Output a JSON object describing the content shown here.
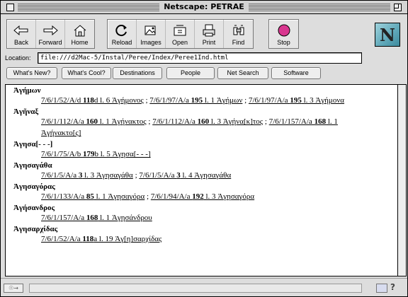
{
  "window": {
    "title": "Netscape: PETRAE"
  },
  "toolbar": {
    "group1": [
      {
        "label": "Back",
        "icon": "back-arrow-icon"
      },
      {
        "label": "Forward",
        "icon": "forward-arrow-icon"
      },
      {
        "label": "Home",
        "icon": "home-icon"
      }
    ],
    "group2": [
      {
        "label": "Reload",
        "icon": "reload-icon"
      },
      {
        "label": "Images",
        "icon": "images-icon"
      },
      {
        "label": "Open",
        "icon": "open-icon"
      },
      {
        "label": "Print",
        "icon": "print-icon"
      },
      {
        "label": "Find",
        "icon": "find-icon"
      }
    ],
    "group3": [
      {
        "label": "Stop",
        "icon": "stop-icon"
      }
    ],
    "logo": "N"
  },
  "location": {
    "label": "Location:",
    "value": "file:///d2Mac-5/Instal/Peree/Index/Peree1Ind.html"
  },
  "directory_buttons": [
    "What's New?",
    "What's Cool?",
    "Destinations",
    "People",
    "Net Search",
    "Software"
  ],
  "entries": [
    {
      "head": "Ἀγήμων",
      "lines": [
        [
          {
            "t": "7/6/1/52/A/d "
          },
          {
            "b": "118"
          },
          {
            "t": "d l. 6 Ἀγήμονος"
          },
          {
            "sep": " ; "
          },
          {
            "t": "7/6/1/97/A/a "
          },
          {
            "b": "195"
          },
          {
            "t": " l. 1 Ἀγήμων"
          },
          {
            "sep": " ; "
          },
          {
            "t": "7/6/1/97/A/a "
          },
          {
            "b": "195"
          },
          {
            "t": " l. 3 Ἀγήμονα"
          }
        ]
      ]
    },
    {
      "head": "Ἀγῆναξ",
      "lines": [
        [
          {
            "t": "7/6/1/112/A/a "
          },
          {
            "b": "160"
          },
          {
            "t": " l. 1 Ἀγήνακτος"
          },
          {
            "sep": " ; "
          },
          {
            "t": "7/6/1/112/A/a "
          },
          {
            "b": "160"
          },
          {
            "t": " l. 3 Ἀγήνα[κ]τος"
          },
          {
            "sep": " ; "
          },
          {
            "t": "7/6/1/157/A/a "
          },
          {
            "b": "168"
          },
          {
            "t": " l. 1"
          }
        ],
        [
          {
            "t": "Ἀγήνακτο[ς]"
          }
        ]
      ]
    },
    {
      "head": "Ἀγησα[- - -]",
      "lines": [
        [
          {
            "t": "7/6/1/75/A/b "
          },
          {
            "b": "179"
          },
          {
            "t": "b l. 5 Ἀγησα[- - -]"
          }
        ]
      ]
    },
    {
      "head": "Ἀγησαγάθα",
      "lines": [
        [
          {
            "t": "7/6/1/5/A/a "
          },
          {
            "b": "3"
          },
          {
            "t": " l. 3 Ἀγησαγάθα"
          },
          {
            "sep": " ; "
          },
          {
            "t": "7/6/1/5/A/a "
          },
          {
            "b": "3"
          },
          {
            "t": " l. 4 Ἀγησαγάθα"
          }
        ]
      ]
    },
    {
      "head": "Ἀγησαγόρας",
      "lines": [
        [
          {
            "t": "7/6/1/133/A/a "
          },
          {
            "b": "85"
          },
          {
            "t": " l. 1 Ἀγησαγόρα"
          },
          {
            "sep": " ; "
          },
          {
            "t": "7/6/1/94/A/a "
          },
          {
            "b": "192"
          },
          {
            "t": " l. 3 Ἀγησαγόρα"
          }
        ]
      ]
    },
    {
      "head": "Ἀγήσανδρος",
      "lines": [
        [
          {
            "t": "7/6/1/157/A/a "
          },
          {
            "b": "168"
          },
          {
            "t": " l. 1 Ἀγησάνδρου"
          }
        ]
      ]
    },
    {
      "head": "Ἀγησαρχίδας",
      "lines": [
        [
          {
            "t": "7/6/1/52/A/a "
          },
          {
            "b": "118"
          },
          {
            "t": "a l. 19 Ἀγ[η]σαρχίδας"
          }
        ]
      ]
    }
  ]
}
